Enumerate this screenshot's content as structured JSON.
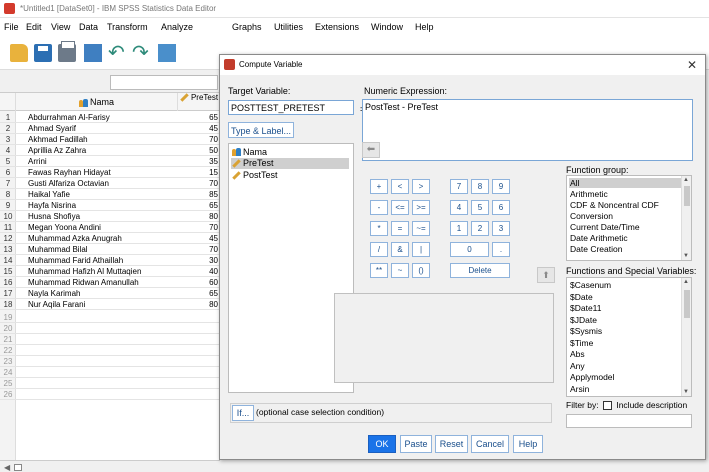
{
  "window": {
    "title": "*Untitled1 [DataSet0] - IBM SPSS Statistics Data Editor",
    "menu": [
      "File",
      "Edit",
      "View",
      "Data",
      "Transform",
      "Analyze",
      "Graphs",
      "Utilities",
      "Extensions",
      "Window",
      "Help"
    ]
  },
  "grid": {
    "columns": {
      "nama": "Nama",
      "pretest": "PreTest"
    },
    "rows": [
      {
        "num": "1",
        "nama": "Abdurrahman Al-Farisy",
        "pretest": "65"
      },
      {
        "num": "2",
        "nama": "Ahmad Syarif",
        "pretest": "45"
      },
      {
        "num": "3",
        "nama": "Akhmad Fadillah",
        "pretest": "70"
      },
      {
        "num": "4",
        "nama": "Aprillia Az Zahra",
        "pretest": "50"
      },
      {
        "num": "5",
        "nama": "Arrini",
        "pretest": "35"
      },
      {
        "num": "6",
        "nama": "Fawas Rayhan Hidayat",
        "pretest": "15"
      },
      {
        "num": "7",
        "nama": "Gusti Alfariza Octavian",
        "pretest": "70"
      },
      {
        "num": "8",
        "nama": "Haikal Yafie",
        "pretest": "85"
      },
      {
        "num": "9",
        "nama": "Hayfa Nisrina",
        "pretest": "65"
      },
      {
        "num": "10",
        "nama": "Husna Shofiya",
        "pretest": "80"
      },
      {
        "num": "11",
        "nama": "Megan Yoona Andini",
        "pretest": "70"
      },
      {
        "num": "12",
        "nama": "Muhammad Azka Anugrah",
        "pretest": "45"
      },
      {
        "num": "13",
        "nama": "Muhammad Bilal",
        "pretest": "70"
      },
      {
        "num": "14",
        "nama": "Muhammad Farid Athaillah",
        "pretest": "30"
      },
      {
        "num": "15",
        "nama": "Muhammad Hafizh Al Muttaqien",
        "pretest": "40"
      },
      {
        "num": "16",
        "nama": "Muhammad Ridwan Amanullah",
        "pretest": "60"
      },
      {
        "num": "17",
        "nama": "Nayla Karimah",
        "pretest": "65"
      },
      {
        "num": "18",
        "nama": "Nur Aqila Farani",
        "pretest": "80"
      }
    ],
    "empty_rows": [
      "19",
      "20",
      "21",
      "22",
      "23",
      "24",
      "25",
      "26"
    ]
  },
  "dialog": {
    "title": "Compute Variable",
    "target_label": "Target Variable:",
    "target_value": "POSTTEST_PRETEST",
    "numeric_label": "Numeric Expression:",
    "expression": "PostTest - PreTest",
    "type_label_button": "Type & Label...",
    "variables": [
      {
        "name": "Nama",
        "icon": "nominal-icon",
        "selected": false
      },
      {
        "name": "PreTest",
        "icon": "scale-pencil-icon",
        "selected": true
      },
      {
        "name": "PostTest",
        "icon": "scale-pencil-icon",
        "selected": false
      }
    ],
    "keypad": [
      "+",
      "<",
      ">",
      "7",
      "8",
      "9",
      "-",
      "<=",
      ">=",
      "4",
      "5",
      "6",
      "*",
      "=",
      "~=",
      "1",
      "2",
      "3",
      "/",
      "&",
      "|",
      "0",
      ".",
      "**",
      "~",
      "()",
      "Delete"
    ],
    "function_group_label": "Function group:",
    "function_groups": [
      "All",
      "Arithmetic",
      "CDF & Noncentral CDF",
      "Conversion",
      "Current Date/Time",
      "Date Arithmetic",
      "Date Creation"
    ],
    "functions_label": "Functions and Special Variables:",
    "functions": [
      "$Casenum",
      "$Date",
      "$Date11",
      "$JDate",
      "$Sysmis",
      "$Time",
      "Abs",
      "Any",
      "Applymodel",
      "Arsin"
    ],
    "filter_label": "Filter by:",
    "include_description": "Include description",
    "if_button": "If...",
    "if_text": "(optional case selection condition)",
    "buttons": [
      "OK",
      "Paste",
      "Reset",
      "Cancel",
      "Help"
    ]
  }
}
